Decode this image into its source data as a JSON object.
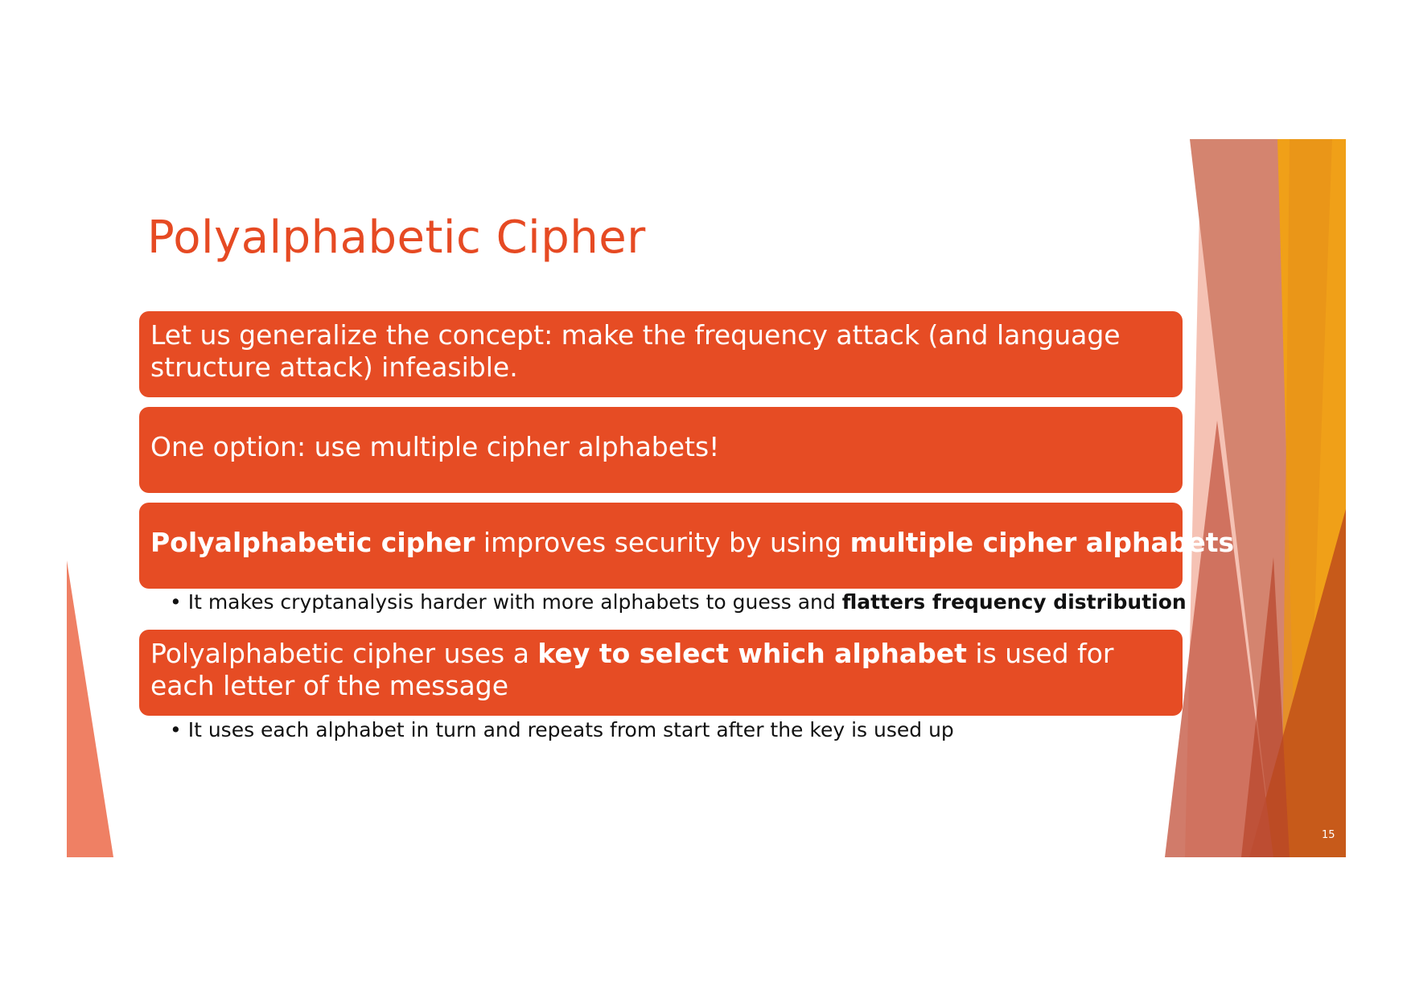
{
  "slide": {
    "title": "Polyalphabetic Cipher",
    "boxes": [
      {
        "text": "Let us generalize the concept: make the frequency attack (and language structure attack) infeasible."
      },
      {
        "text": "One option: use multiple cipher alphabets!"
      },
      {
        "bold_1": "Polyalphabetic cipher",
        "text_1": " improves security by using ",
        "bold_2": "multiple cipher alphabets"
      },
      {
        "text_1": "Polyalphabetic cipher uses a ",
        "bold_1": "key to select which alphabet",
        "text_2": " is used for each letter of the message"
      }
    ],
    "bullets": [
      {
        "marker": "•",
        "text_1": " It makes cryptanalysis harder with more alphabets to guess and ",
        "bold_1": "flatters frequency distribution"
      },
      {
        "marker": "•",
        "text_1": " It uses each alphabet in turn and repeats from start after the key is used up"
      }
    ],
    "page_number": "15"
  },
  "colors": {
    "accent": "#e64c24",
    "title": "#e64a23",
    "gold": "#f29a12",
    "text": "#111111"
  }
}
